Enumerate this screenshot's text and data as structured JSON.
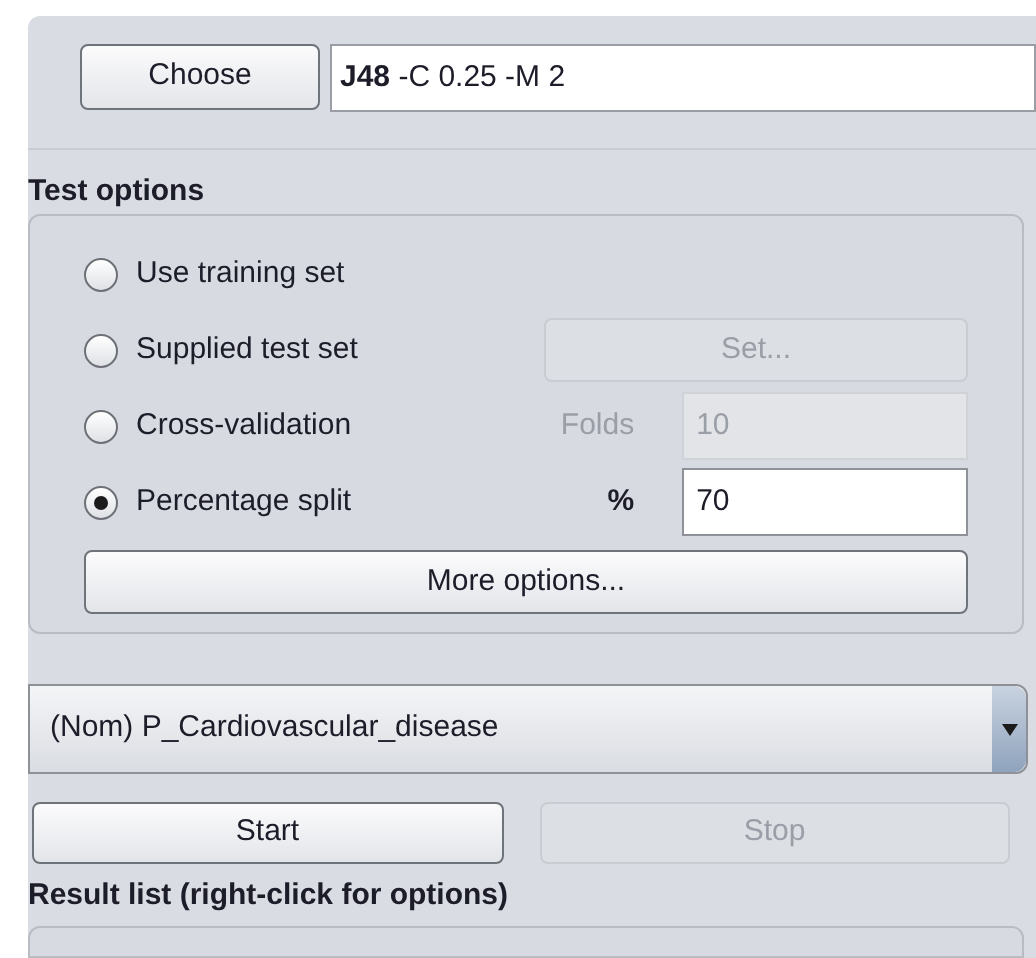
{
  "classifier": {
    "button": "Choose",
    "spec": "**J48** -C 0.25 -M 2"
  },
  "test_options": {
    "title": "Test options",
    "options": [
      {
        "kind": "plain",
        "label": "Use training set",
        "selected": false
      },
      {
        "kind": "button",
        "label": "Supplied test set",
        "selected": false,
        "button": "Set...",
        "disabled": true
      },
      {
        "kind": "field",
        "label": "Cross-validation",
        "selected": false,
        "field_label": "Folds",
        "value": "10",
        "disabled": true
      },
      {
        "kind": "field",
        "label": "Percentage split",
        "selected": true,
        "field_label": "%",
        "value": "70",
        "disabled": false
      }
    ],
    "more_button": "More options..."
  },
  "class_dropdown": {
    "value": "(Nom) P_Cardiovascular_disease"
  },
  "buttons": [
    {
      "label": "Start",
      "disabled": false
    },
    {
      "label": "Stop",
      "disabled": true
    }
  ],
  "result_list": {
    "title": "Result list (right-click for options)"
  }
}
